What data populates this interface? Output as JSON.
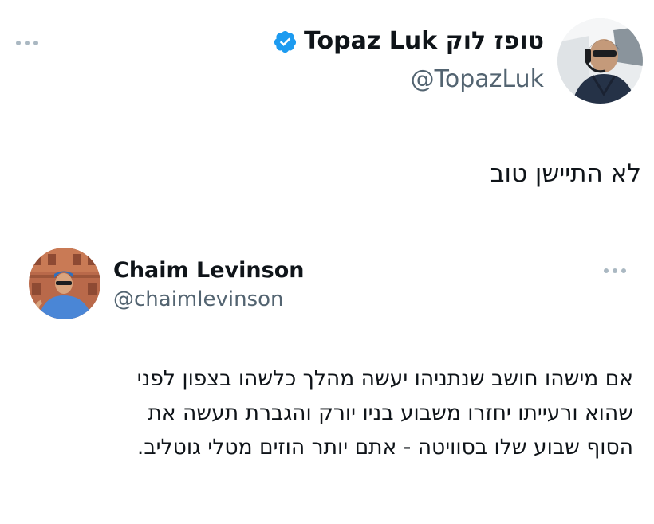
{
  "tweet": {
    "author": {
      "display_name": "טופז לוק Topaz Luk",
      "handle": "@TopazLuk",
      "verified": true
    },
    "text": "לא התיישן טוב",
    "more_icon": "more-horizontal-icon"
  },
  "quoted_tweet": {
    "author": {
      "display_name": "Chaim Levinson",
      "handle": "@chaimlevinson"
    },
    "lines": [
      "אם מישהו חושב שנתניהו יעשה מהלך כלשהו בצפון לפני",
      "שהוא ורעייתו יחזרו משבוע בניו יורק והגברת תעשה את",
      "הסוף שבוע שלו בסוויטה - אתם יותר הוזים מטלי גוטליב."
    ],
    "more_icon": "more-horizontal-icon"
  },
  "colors": {
    "text": "#0f1419",
    "secondary_text": "#536471",
    "verified_blue": "#1d9bf0",
    "more_dots": "#aab8c2"
  }
}
